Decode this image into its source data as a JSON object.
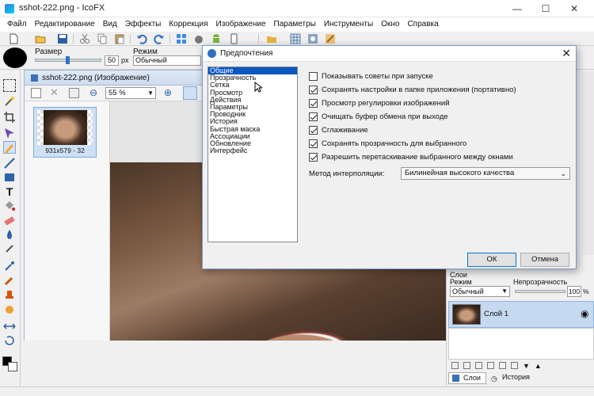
{
  "window": {
    "title": "sshot-222.png - IcoFX",
    "minimize": "—",
    "maximize": "☐",
    "close": "✕"
  },
  "menu": [
    "Файл",
    "Редактирование",
    "Вид",
    "Эффекты",
    "Коррекция",
    "Изображение",
    "Параметры",
    "Инструменты",
    "Окно",
    "Справка"
  ],
  "options_bar": {
    "size_label": "Размер",
    "size_value": "50",
    "size_unit": "px",
    "mode_label": "Режим",
    "mode_value": "Обычный"
  },
  "document": {
    "title": "sshot-222.png (Изображение)",
    "zoom": "55 %",
    "thumb_caption": "931x579 - 32"
  },
  "dialog": {
    "title": "Предпочтения",
    "categories": [
      "Общие",
      "Прозрачность",
      "Сетка",
      "Просмотр",
      "Действия",
      "Параметры",
      "Проводник",
      "История",
      "Быстрая маска",
      "Ассоциации",
      "Обновление",
      "Интерфейс"
    ],
    "selected_category": "Общие",
    "options": [
      {
        "label": "Показывать советы при запуске",
        "checked": false
      },
      {
        "label": "Сохранять настройки в папке приложения (портативно)",
        "checked": true
      },
      {
        "label": "Просмотр регулировки изображений",
        "checked": true
      },
      {
        "label": "Очищать буфер обмена при выходе",
        "checked": true
      },
      {
        "label": "Сглаживание",
        "checked": true
      },
      {
        "label": "Сохранять прозрачность для выбранного",
        "checked": true
      },
      {
        "label": "Разрешить перетаскивание выбранного между окнами",
        "checked": true
      }
    ],
    "interp_label": "Метод интерполяции:",
    "interp_value": "Билинейная высокого качества",
    "ok": "ОК",
    "cancel": "Отмена"
  },
  "layers_panel": {
    "title": "Слои",
    "mode_label": "Режим",
    "mode_value": "Обычный",
    "opacity_label": "Непрозрачность",
    "opacity_value": "100",
    "opacity_unit": "%",
    "layer_name": "Слой 1",
    "tab_layers": "Слои",
    "tab_history": "История"
  },
  "colors": {
    "accent": "#0a57c2",
    "doc_border": "#9eb7d6",
    "layer_selected": "#c5d9f1"
  }
}
